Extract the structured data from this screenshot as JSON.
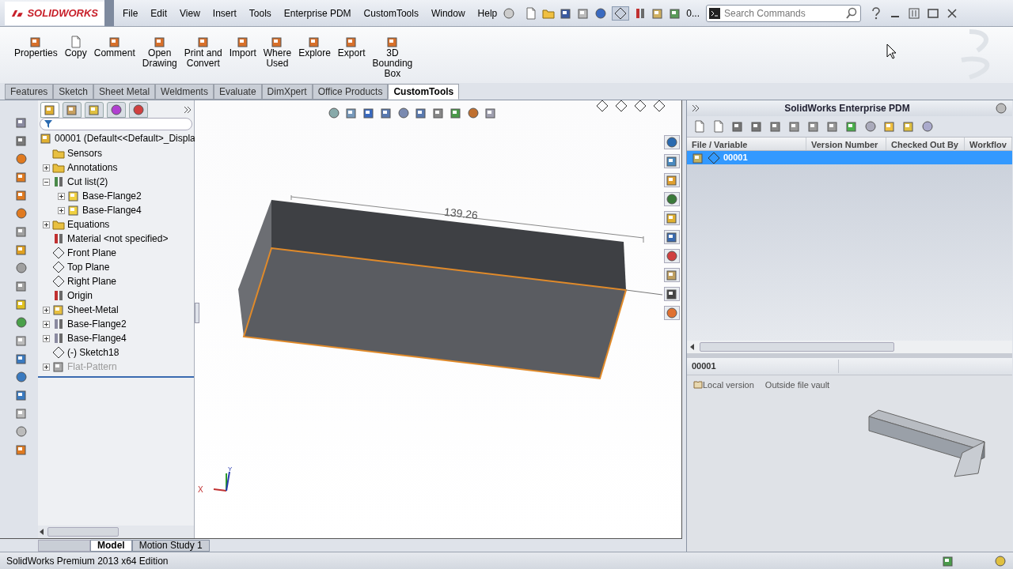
{
  "app": {
    "logo": "SOLIDWORKS"
  },
  "menu": [
    "File",
    "Edit",
    "View",
    "Insert",
    "Tools",
    "Enterprise PDM",
    "CustomTools",
    "Window",
    "Help"
  ],
  "quick_toolbar": {
    "overflow": "0...",
    "search": {
      "placeholder": "Search Commands"
    }
  },
  "command_buttons": [
    {
      "lines": [
        "Properties"
      ],
      "kind": "properties"
    },
    {
      "lines": [
        "Copy"
      ],
      "kind": "copy"
    },
    {
      "lines": [
        "Comment"
      ],
      "kind": "comment"
    },
    {
      "lines": [
        "Open",
        "Drawing"
      ],
      "kind": "drawing"
    },
    {
      "lines": [
        "Print and",
        "Convert"
      ],
      "kind": "print"
    },
    {
      "lines": [
        "Import"
      ],
      "kind": "import"
    },
    {
      "lines": [
        "Where",
        "Used"
      ],
      "kind": "where"
    },
    {
      "lines": [
        "Explore"
      ],
      "kind": "explore"
    },
    {
      "lines": [
        "Export"
      ],
      "kind": "export"
    },
    {
      "lines": [
        "3D",
        "Bounding",
        "Box"
      ],
      "kind": "box"
    }
  ],
  "tabs": [
    {
      "label": "Features",
      "selected": false
    },
    {
      "label": "Sketch",
      "selected": false
    },
    {
      "label": "Sheet Metal",
      "selected": false
    },
    {
      "label": "Weldments",
      "selected": false
    },
    {
      "label": "Evaluate",
      "selected": false
    },
    {
      "label": "DimXpert",
      "selected": false
    },
    {
      "label": "Office Products",
      "selected": false
    },
    {
      "label": "CustomTools",
      "selected": true
    }
  ],
  "panel_tabs": [
    {
      "selected": true
    },
    {
      "selected": false
    },
    {
      "selected": false
    },
    {
      "selected": false
    },
    {
      "selected": false
    }
  ],
  "tree": {
    "root": "00001  (Default<<Default>_Displa",
    "items": [
      {
        "label": "Sensors",
        "kind": "sensor",
        "disabled": false
      },
      {
        "label": "Annotations",
        "kind": "annotation",
        "expanded": false,
        "disabled": false
      },
      {
        "label": "Cut list(2)",
        "kind": "cutlist",
        "expanded": true,
        "disabled": false,
        "children": [
          {
            "label": "Base-Flange2",
            "kind": "body",
            "expanded": false,
            "disabled": false
          },
          {
            "label": "Base-Flange4",
            "kind": "body",
            "expanded": false,
            "disabled": false
          }
        ]
      },
      {
        "label": "Equations",
        "kind": "equations",
        "expanded": false,
        "disabled": false
      },
      {
        "label": "Material <not specified>",
        "kind": "material",
        "disabled": false
      },
      {
        "label": "Front Plane",
        "kind": "plane",
        "disabled": false
      },
      {
        "label": "Top Plane",
        "kind": "plane",
        "disabled": false
      },
      {
        "label": "Right Plane",
        "kind": "plane",
        "disabled": false
      },
      {
        "label": "Origin",
        "kind": "origin",
        "disabled": false
      },
      {
        "label": "Sheet-Metal",
        "kind": "sheetmetal",
        "expanded": false,
        "disabled": false
      },
      {
        "label": "Base-Flange2",
        "kind": "flange",
        "expanded": false,
        "disabled": false
      },
      {
        "label": "Base-Flange4",
        "kind": "flange",
        "expanded": false,
        "disabled": false
      },
      {
        "label": "(-) Sketch18",
        "kind": "sketch",
        "disabled": false
      },
      {
        "label": "Flat-Pattern",
        "kind": "flatpattern",
        "expanded": false,
        "disabled": true
      }
    ]
  },
  "viewport": {
    "dimension": "139.26",
    "axis_x": "X",
    "axis_y": "Y"
  },
  "bottom_tabs": [
    {
      "label": "Model",
      "selected": true
    },
    {
      "label": "Motion Study 1",
      "selected": false
    }
  ],
  "pdm": {
    "title": "SolidWorks Enterprise PDM",
    "columns": [
      "File / Variable",
      "Version Number",
      "Checked Out By",
      "Workflov"
    ],
    "rows": [
      {
        "name": "00001",
        "selected": true
      }
    ],
    "preview": {
      "name": "00001",
      "version": "Local version",
      "location": "Outside file vault"
    }
  },
  "status_bar": "SolidWorks Premium 2013 x64 Edition"
}
